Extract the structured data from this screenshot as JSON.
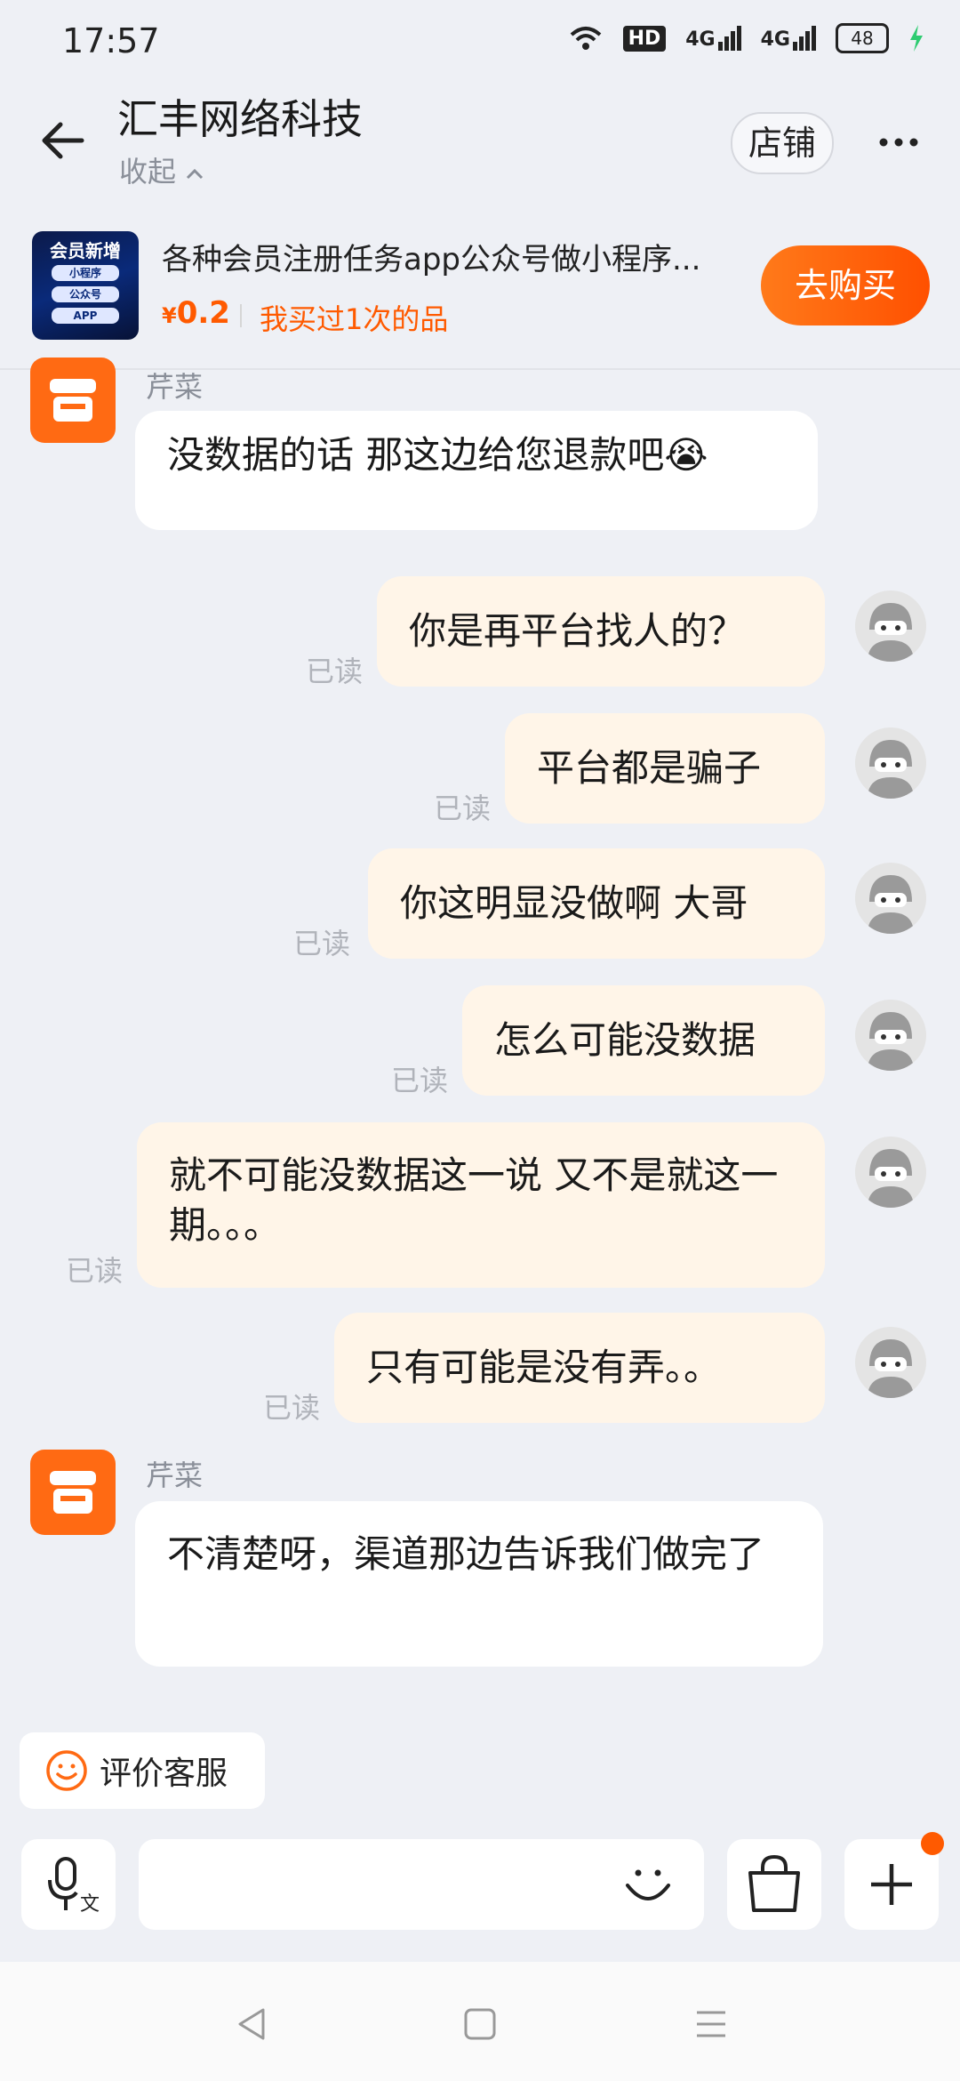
{
  "status_bar": {
    "time": "17:57",
    "network_1": "4G",
    "network_2": "4G",
    "hd_label": "HD",
    "battery": "48"
  },
  "header": {
    "title": "汇丰网络科技",
    "collapse_label": "收起",
    "shop_button": "店铺"
  },
  "product": {
    "thumb_title": "会员新增",
    "thumb_pills": [
      "小程序",
      "公众号",
      "APP"
    ],
    "title": "各种会员注册任务app公众号做小程序...",
    "price_symbol": "¥",
    "price_value": "0.2",
    "bought_text": "我买过1次的品",
    "buy_button": "去购买"
  },
  "messages": [
    {
      "from": "shop",
      "sender": "芹菜",
      "text": "没数据的话 那这边给您退款吧😭"
    },
    {
      "from": "user",
      "text": "你是再平台找人的？",
      "status": "已读"
    },
    {
      "from": "user",
      "text": "平台都是骗子",
      "status": "已读"
    },
    {
      "from": "user",
      "text": "你这明显没做啊 大哥",
      "status": "已读"
    },
    {
      "from": "user",
      "text": "怎么可能没数据",
      "status": "已读"
    },
    {
      "from": "user",
      "text": "就不可能没数据这一说 又不是就这一期。。。",
      "status": "已读"
    },
    {
      "from": "user",
      "text": "只有可能是没有弄。。",
      "status": "已读"
    },
    {
      "from": "shop",
      "sender": "芹菜",
      "text": "不清楚呀，渠道那边告诉我们做完了"
    }
  ],
  "rate_service": "评价客服",
  "colors": {
    "accent": "#ff5a00",
    "shop_avatar": "#ff6a13",
    "outgoing_bubble": "#fff5e8",
    "background": "#eef0f5"
  }
}
